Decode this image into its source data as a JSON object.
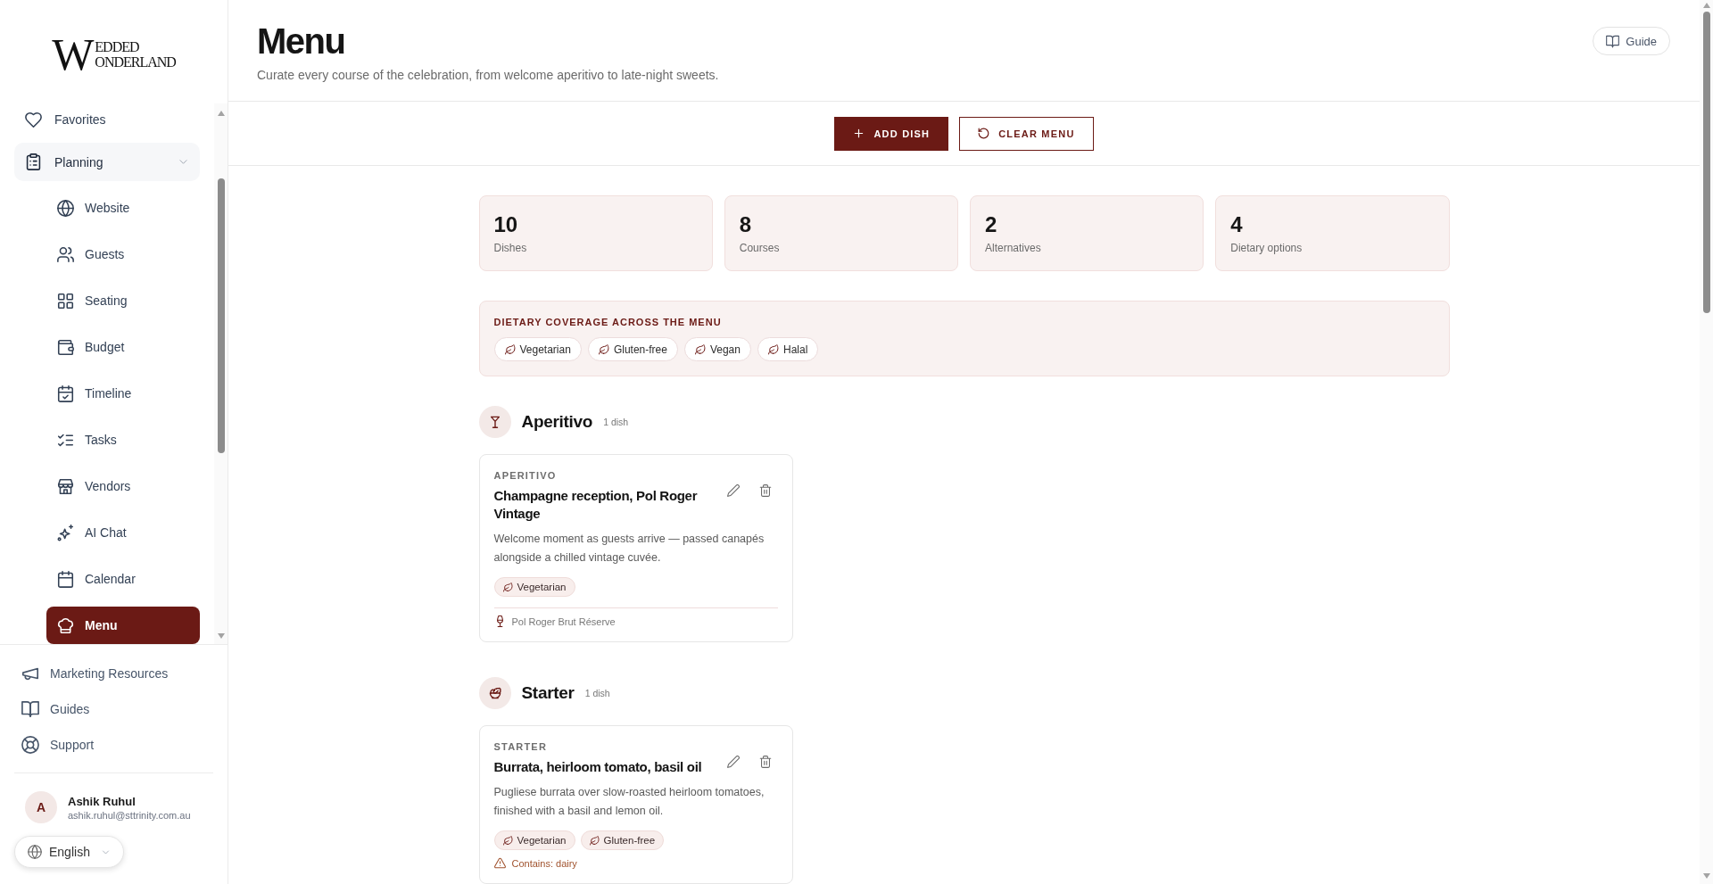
{
  "sidebar": {
    "logo": {
      "initial": "W",
      "lines": [
        "EDDED",
        "ONDERLAND"
      ]
    },
    "nav": [
      {
        "label": "Favorites",
        "selected": false
      },
      {
        "label": "Planning",
        "selected": false,
        "expanded": true,
        "children": [
          {
            "label": "Website",
            "selected": false
          },
          {
            "label": "Guests",
            "selected": false
          },
          {
            "label": "Seating",
            "selected": false
          },
          {
            "label": "Budget",
            "selected": false
          },
          {
            "label": "Timeline",
            "selected": false
          },
          {
            "label": "Tasks",
            "selected": false
          },
          {
            "label": "Vendors",
            "selected": false
          },
          {
            "label": "AI Chat",
            "selected": false
          },
          {
            "label": "Calendar",
            "selected": false
          },
          {
            "label": "Menu",
            "selected": true
          }
        ]
      }
    ],
    "footer_links": [
      "Marketing Resources",
      "Guides",
      "Support"
    ],
    "user": {
      "initial": "A",
      "name": "Ashik Ruhul",
      "email": "ashik.ruhul@sttrinity.com.au"
    },
    "language": "English"
  },
  "header": {
    "title": "Menu",
    "subtitle": "Curate every course of the celebration, from welcome aperitivo to late-night sweets.",
    "guide_button": "Guide"
  },
  "toolbar": {
    "buttons": [
      {
        "label": "ADD DISH",
        "kind": "primary"
      },
      {
        "label": "CLEAR MENU",
        "kind": "outline"
      }
    ]
  },
  "stats": [
    {
      "value": "10",
      "label": "Dishes"
    },
    {
      "value": "8",
      "label": "Courses"
    },
    {
      "value": "2",
      "label": "Alternatives"
    },
    {
      "value": "4",
      "label": "Dietary options"
    }
  ],
  "dietary_coverage": {
    "title": "DIETARY COVERAGE ACROSS THE MENU",
    "tags": [
      "Vegetarian",
      "Gluten-free",
      "Vegan",
      "Halal"
    ]
  },
  "courses": [
    {
      "name": "Aperitivo",
      "count": "1 dish",
      "dishes": [
        {
          "course_label": "APERITIVO",
          "title": "Champagne reception, Pol Roger Vintage",
          "description": "Welcome moment as guests arrive — passed canapés alongside a chilled vintage cuvée.",
          "tags": [
            "Vegetarian"
          ],
          "notes": [
            {
              "kind": "pairing",
              "text": "Pol Roger Brut Réserve"
            }
          ]
        }
      ]
    },
    {
      "name": "Starter",
      "count": "1 dish",
      "dishes": [
        {
          "course_label": "STARTER",
          "title": "Burrata, heirloom tomato, basil oil",
          "description": "Pugliese burrata over slow-roasted heirloom tomatoes, finished with a basil and lemon oil.",
          "tags": [
            "Vegetarian",
            "Gluten-free"
          ],
          "notes": [
            {
              "kind": "allergen",
              "text": "Contains: dairy"
            }
          ]
        }
      ]
    }
  ]
}
